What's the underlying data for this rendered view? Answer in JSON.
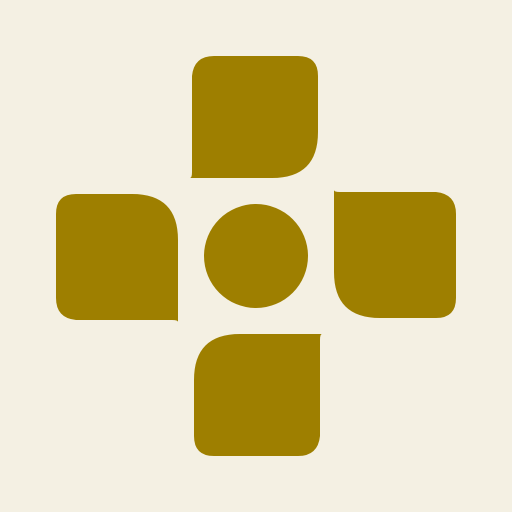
{
  "icon": {
    "name": "cross-with-center-dot-icon",
    "colors": {
      "background": "#F4F0E3",
      "glyph": "#9E7F00"
    }
  }
}
